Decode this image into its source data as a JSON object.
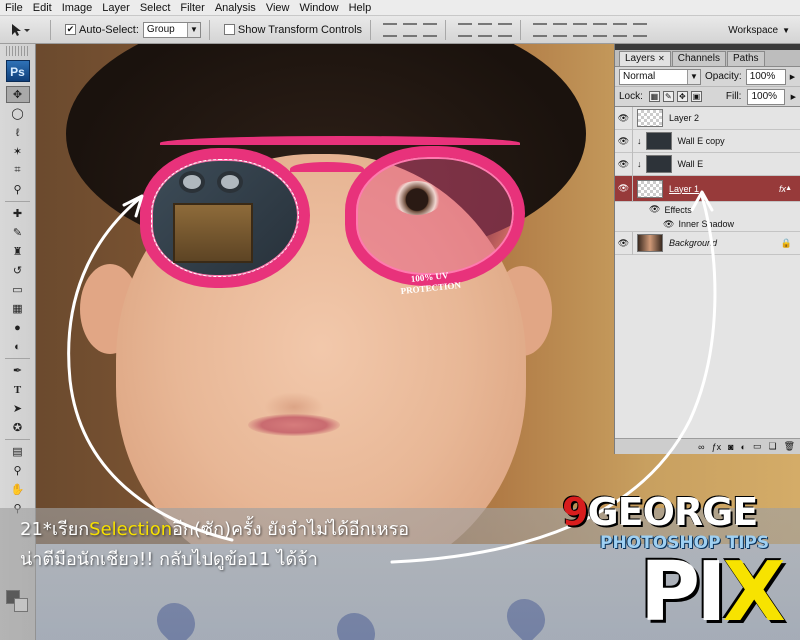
{
  "menu": [
    "File",
    "Edit",
    "Image",
    "Layer",
    "Select",
    "Filter",
    "Analysis",
    "View",
    "Window",
    "Help"
  ],
  "options": {
    "auto_select_label": "Auto-Select:",
    "auto_select_checked": true,
    "auto_select_value": "Group",
    "show_transform_label": "Show Transform Controls",
    "show_transform_checked": false,
    "workspace_label": "Workspace"
  },
  "toolbox": {
    "logo": "Ps"
  },
  "layers_panel": {
    "tabs": [
      "Layers",
      "Channels",
      "Paths"
    ],
    "blend_mode": "Normal",
    "opacity_label": "Opacity:",
    "opacity": "100%",
    "lock_label": "Lock:",
    "fill_label": "Fill:",
    "fill": "100%",
    "layers": [
      {
        "name": "Layer 2"
      },
      {
        "name": "Wall E copy"
      },
      {
        "name": "Wall E"
      },
      {
        "name": "Layer 1"
      },
      {
        "name": "Background"
      }
    ],
    "effects_label": "Effects",
    "effect_item": "Inner Shadow",
    "fx_badge": "fx"
  },
  "photo": {
    "lens_text_1": "100% UV",
    "lens_text_2": "PROTECTION"
  },
  "caption": {
    "line1_pre": "21*เรียก",
    "line1_hl": "Selection",
    "line1_post": "อีก(ซัก)ครั้ง  ยังจำไม่ได้อีกเหรอ",
    "line2": "น่าตีมือนักเชียว!!  กลับไปดูข้อ11  ได้จ้า"
  },
  "logo": {
    "nine": "9",
    "george": "GEORGE",
    "tips": "PHOTOSHOP TIPS",
    "pi": "PI",
    "x": "X"
  },
  "colors": {
    "selected_layer": "#973a3a",
    "glasses": "#e8327b",
    "caption_highlight": "#f6e000",
    "logo_red": "#d81d1d"
  }
}
